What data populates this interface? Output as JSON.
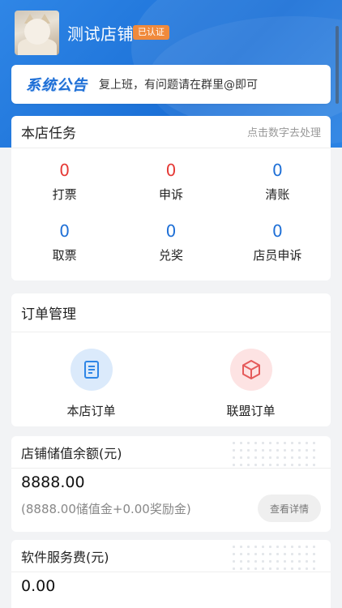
{
  "header": {
    "shop_name": "测试店铺",
    "verified_badge": "已认证",
    "colors": {
      "primary": "#1e6fd6",
      "badge": "#f08a3c"
    }
  },
  "notice": {
    "title": "系统公告",
    "text": "复上班，有问题请在群里@即可"
  },
  "tasks": {
    "title": "本店任务",
    "hint": "点击数字去处理",
    "items": [
      {
        "value": "0",
        "label": "打票",
        "color": "#e53935"
      },
      {
        "value": "0",
        "label": "申诉",
        "color": "#e53935"
      },
      {
        "value": "0",
        "label": "清账",
        "color": "#1e6fd6"
      },
      {
        "value": "0",
        "label": "取票",
        "color": "#1e6fd6"
      },
      {
        "value": "0",
        "label": "兑奖",
        "color": "#1e6fd6"
      },
      {
        "value": "0",
        "label": "店员申诉",
        "color": "#1e6fd6"
      }
    ]
  },
  "orders": {
    "title": "订单管理",
    "items": [
      {
        "label": "本店订单",
        "icon": "document-icon"
      },
      {
        "label": "联盟订单",
        "icon": "cube-icon"
      }
    ]
  },
  "balance": {
    "title": "店铺储值余额(元)",
    "amount": "8888.00",
    "detail": "(8888.00储值金+0.00奖励金)",
    "button": "查看详情"
  },
  "service_fee": {
    "title": "软件服务费(元)",
    "amount": "0.00"
  }
}
